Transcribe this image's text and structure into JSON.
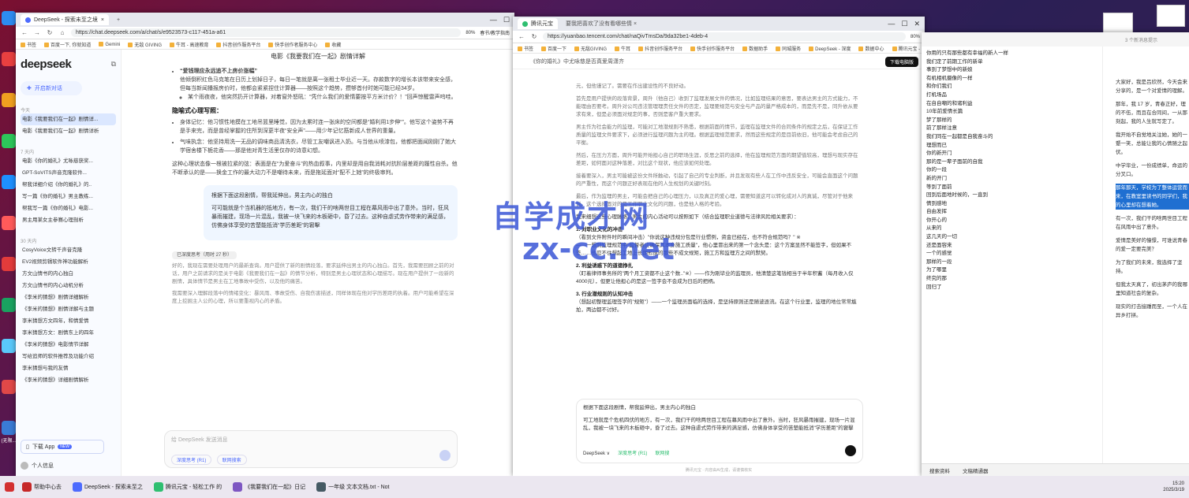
{
  "desktop": {
    "icons": [
      {
        "color": "#2d8cf0",
        "label": ""
      },
      {
        "color": "#e94040",
        "label": ""
      },
      {
        "color": "#f0a020",
        "label": ""
      },
      {
        "color": "#2dc75a",
        "label": ""
      },
      {
        "color": "#1e90ff",
        "label": ""
      },
      {
        "color": "#ff5a5a",
        "label": ""
      },
      {
        "color": "#e23b3b",
        "label": ""
      },
      {
        "color": "#1aa260",
        "label": ""
      },
      {
        "color": "#5ac8fa",
        "label": ""
      },
      {
        "color": "#e04848",
        "label": ""
      },
      {
        "color": "#3a7bd5",
        "label": "(无限..."
      }
    ]
  },
  "window_a": {
    "tab_active": "DeepSeek - 探索未至之境",
    "tab_inactive": "",
    "url": "https://chat.deepseek.com/a/chat/s/e9523573-c117-451a-a61",
    "zoom": "80%",
    "tab_extra": "春节/教学指南",
    "bookmarks": [
      "书签",
      "百度一下, 你就知道",
      "Gemini",
      "无敌 GIVING",
      "牛耳 - 高速教育",
      "抖音创作服务平台",
      "快手创作者服务中心",
      "收藏"
    ],
    "sidebar": {
      "logo": "deepseek",
      "new_chat": "开启新对话",
      "groups": [
        {
          "label": "今天",
          "items": [
            "电影《我要我们在一起》剧情详...",
            "电影《我要我们在一起》剧情详析"
          ]
        },
        {
          "label": "7 天内",
          "items": [
            "电影《你的婚礼》尤咏慈获奖...",
            "GPT-SoVITS声音克隆软件...",
            "帮我详细介绍《你的婚礼》的..",
            "写一篇《你的婚礼》男主教练...",
            "帮我写一篇《你的婚礼》电影...",
            "男主用某女主参赛心理剖析"
          ]
        },
        {
          "label": "30 天内",
          "items": [
            "CosyVoice文转千声音克隆",
            "EV2视频剪辑软件神功能解析",
            "方文山情书的内心独白",
            "方文山情书的内心动机分析",
            "《李米的猜想》剧情详细解析",
            "《李米的猜想》剧情详解与主题",
            "李米猜想方文四年，和情爱情",
            "李米猜想方文：剧情东上的四年",
            "《李米的猜想》电影情节详解",
            "写给追师的软件推荐及功能介绍",
            "李米猜想与我的友情",
            "《李米的猜想》详细剧情解析"
          ]
        }
      ],
      "app_label": "下载 App",
      "app_badge": "NEW",
      "profile": "个人信息"
    },
    "main": {
      "title": "电影《我要我们在一起》剧情详解",
      "point1_title": "“爱钱理应永远追不上房价涨幅”",
      "point1_body": "他倾倒积红色马克笔在日历上划掉日子，每日一笔就是离一张租士毕业近一天。存款数字的增长本该带来安全感，但每当新闻播报房价时，他都会紧紧捏住计算器——按照这个趋势，攒够首付时她可能已经34岁。",
      "point1_sub": "某个雨夜夜，他突然扔开计算器，对着窗外怒吼：“凭什么我们的爱情要按平方米计价？！”回声惊醒雷声呜哇。",
      "section_title": "隐喻式心理写照：",
      "bullet1": "身体记忆：他习惯性地摸在工地吊篮里睡觉，因为太累时连一张床的空间都是“婚利用1步伸“”。他写这个姿势不再是手来完，而是曾经掌握的住所到深更半夜“安全声”——用少年记忆筋新成人世界的重量。",
      "bullet2": "气味执念：他坚持用洗一无品的调味商品清洗衣，尽管工友嘲讽进入奶。与当他从喷漆包，他都把面闻刚刚了她大学宿舍楼下栀花香——那是他对青生活里仅存的诗意幻想。",
      "summary": "这种心理状态像一根被拉紧的弦：表面是在“为爱奋斗”的热血叙事，内里却是用自我消耗对抗阶层差距的履性自杀。他不断承认的是——换金工作的最大动力不是嘲待未来，而是拖延面对“配不上她”的终极审判。",
      "user_prompt_title": "根据下面这段剧情，帮我延伸出，男主内心的独白",
      "user_prompt_body": "可可能就是个当机器的抵地方，有一次，我们干的啥两世目工程在幕风雨中出了意外。当时，狂风暴雨摧建，现场一片混乱，我被一块飞来的木板砸中，昏了过去。这种自虐式劳作带来的满足感，仿佛身体享受的苦楚能抵消“学历差距”的窘擊",
      "thinking_tag": "已深度思考（用时 27 秒）",
      "thinking_body": "好的，我现在需要处理用户的最新查询。用户提供了新的剧情段落，要求延伸出男主的内心独白。首先，我需要回顾之前的对话，用户之前请求的是关于电影《我要我们在一起》的情节分析，特别是男主心理状态和心理描写。现在用户提供了一段新的剧情，具体情节是男主在工地事故中受伤，以及他的痛苦。",
      "thinking_more": "我需要深入理解段落中的情绪变化：暴风雨、事故受伤、自我伤害描述，同样体现在他对学历差距的执着。用户可能希望在深度上挖掘主人公的心理，所以要重视内心的矛盾。",
      "input_placeholder": "给 DeepSeek 发送消息",
      "chip1": "深度思考 (R1)",
      "chip2": "联网搜索"
    }
  },
  "window_b": {
    "tab_active": "腾讯元宝",
    "tab_extra": "要我把喜欢了没有看哪些情 ×",
    "url": "https://yuanbao.tencent.com/chat/naQivTmsDa/9da32be1-4deb-4",
    "zoom": "80%",
    "bookmarks": [
      "书签",
      "百度一下",
      "无敌GIVING",
      "牛耳",
      "抖音创作服务平台",
      "快手创作服务平台",
      "数据助手",
      "同城服务",
      "DeepSeek - 深度",
      "数据中心",
      "腾讯元宝 - 轻松工作"
    ],
    "header_title": "《你的婚礼》中尤咏慈是否真爱周潇齐",
    "download_btn": "下载电脑版",
    "para1": "元，但他谨记了。需要在作出建设性的不良好动。",
    "para2": "首先是用户提供的段落背景，周升（他自己）收到了监理发展文件的情况，比如监理结果的意思，要表达男主的方式能力，不能理由否要考。周升对公司违法管理理责任文件的否定，监理要规范与安全与产品的量严格成本的，而是先不是，同升依从要求有来，但是必须面对规定的事，否则是客户重大要求。",
    "para3": "男主作为社会能力的监理，可能对工地潜规则不熟悉，根据前面的情节，监理在监理文件的合同条件的规定之后，在保证工作质量的监理文件要求下，必须进行监理问题为主的理。根据监理规范要求，然而这些规定的是目前依旧，他可能会考虑自己的平衡。",
    "para4": "然后，在压力方面，周升可能开始担心自己的职场生涯，反思之前的选择，他在监理规范方面的期望值较高，理想与现实存在差距，如何面对这种落差，对比这个现状，他应该如何处理。",
    "para5": "接着要深入，男主可能被这份文件所触动，引起了自己的专业判断，并且发现有些人在工作中违反安全，可能会直面这个问题的严重性，而这个问题正好表现在他的人生规划的关键时刻。",
    "para6": "最后，作为监理的男主，可能会把自己的心理压力，以及真正的爱心理，需要知道这可以转化成对人的真诚，尽管对于他来说，这个选择面对的是工作职业文化的问题，也是他人格的考验。",
    "lead": "我来细想这些心理脉络，男主的内心活动可以按照如下（结合监理职业道德与法律风险相关要求）：",
    "h1": "1. 对职业文化的冲击",
    "b1": "（看到文件附件时的瞬间冲击）\"你说这种违规分包是行业惯例，资金已经在，也不符合规范吗？\" ※",
    "b1b": "——一想到监理规范中\"监督者应确保其本身施工质量\"，他心里冒出来的第一个念头是：这个方案显然不能签字，但如果不签……他忍不住想起工地上长期形成的那些不成文规矩，施工方和监理方之间的默契。",
    "h2": "2. 利益诱惑下的道德挣扎",
    "b2": "（盯着律师事务所的\"两个月工资都不止这个数..\"※）——作为刚毕业的监理员，他清楚这笔钱相当于半年积蓄（每月收入仅4000元），但更让他担心的是这一签字会不会成为日后的把柄。",
    "h3": "3. 行业潜规则的认知冲击",
    "b3": "（想起初整理监理签字的\"规矩\"）——一个监理员面临的选择，是坚持原则还是随波逐流。在这个行业里，监理的地位常常尴尬，两边都不讨好。",
    "input_title": "根据下面这段剧情，帮我延伸出，男主内心的独白",
    "input_body": "可工地就是个危机四伏的地方，有一次，我们干的啥两世目工程在幕风雨中出了意外。当时，狂风暴雨摧建，现场一片混乱，我被一块飞来的木板砸中，昏了过去。这种自虐式劳作带来的满足感，仿佛身体享受的苦楚能抵消\"学历差距\"的窘擊",
    "model_label": "DeepSeek ∨",
    "chip1": "深度思考 (R1)",
    "chip2": "联网搜",
    "footer": "腾讯元宝 · 内容由AI生成，请谨慎核实"
  },
  "watermark": {
    "line1": "自学成才网",
    "line2": "zx-cc.net"
  },
  "window_c": {
    "top_text": "3 个新消息提示",
    "list": [
      "你用的只有那些都有幸福的新人一样",
      "我们定了前期工作的新单",
      "事到了梦想中的新娘",
      "有机相机摄像的一样",
      "和你们我们",
      "打机场品",
      "在自自嘲的和诸利益",
      "10年前爱情长篇",
      "梦了那样的",
      "前了那样注意",
      "我们同在一起都是自我奋斗的",
      "理想而已",
      "你的新开门",
      "那的是一辈子面前的自我",
      "你的一段",
      "新的开门",
      "等到了面前",
      "回到后面地时候的，一直到",
      "情到感地",
      "自由发挥",
      "你开心的",
      "从来的",
      "这几天的一切",
      "还是面容来",
      "一个的感觉",
      "那样的一段",
      "为了哪里",
      "终究的那",
      "回归了"
    ],
    "right_paras": [
      "大家好，我是吕欣然，今天会来分享的，是一个对爱情的理解。",
      "那年，我 17 岁，青春正好，理的不伍，而且在合同间，一从那刻起，我的人生就写定了。",
      "我开始不自觉地关注她，她的一颦一笑，总能让我的心情随之起伏。",
      "中学毕业，一份成绩单，命运的分叉口。",
      "有一次，我们干的啥两世目工程在风雨中出了意外。",
      "爱情是美好的憧憬，可谁说青春的爱一定要完美？",
      "为了我们的未来，我选择了坚持。",
      "但我太天真了，初出茅庐的我哪里知道社会的复杂。",
      "现实的打击接踵而至，一个人在异乡打拼。"
    ],
    "highlight": "那年那天，学校为了整体运营而来，在教室里读书的同学们，我的心里却在想着她。",
    "bottom_items": [
      "搜索资料",
      "文稿精通器"
    ]
  },
  "taskbar": {
    "items": [
      "帮助中心去",
      "DeepSeek - 探索未至之",
      "腾讯元宝 - 轻松工作 的",
      "《我要我们在一起》日记",
      "一年级 文本文档.txt - Not"
    ],
    "time": "15:20",
    "date": "2025/3/19"
  }
}
